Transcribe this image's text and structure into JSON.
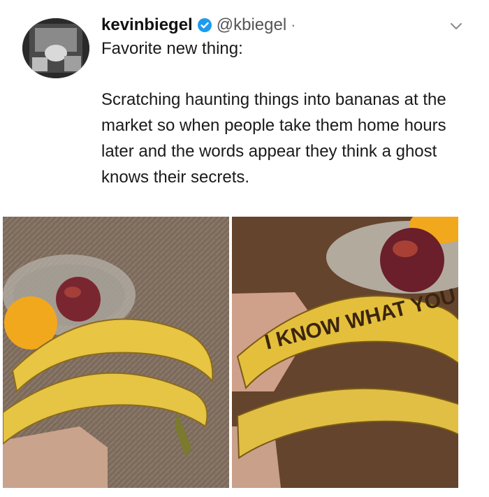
{
  "tweet": {
    "display_name": "kevinbiegel",
    "handle": "@kbiegel",
    "separator": "·",
    "lead_line": "Favorite new thing:",
    "body": "Scratching haunting things into bananas at the market so when people take them home hours later and the words appear they think a ghost knows their secrets.",
    "icons": {
      "verified": "verified-badge-icon",
      "menu": "chevron-down-icon"
    }
  },
  "photos": {
    "right_banana_scratched_text": "I KNOW WHAT YOU DID"
  },
  "colors": {
    "verified": "#1d9bf0",
    "banana": "#e8c542",
    "table": "#6a4a32"
  }
}
